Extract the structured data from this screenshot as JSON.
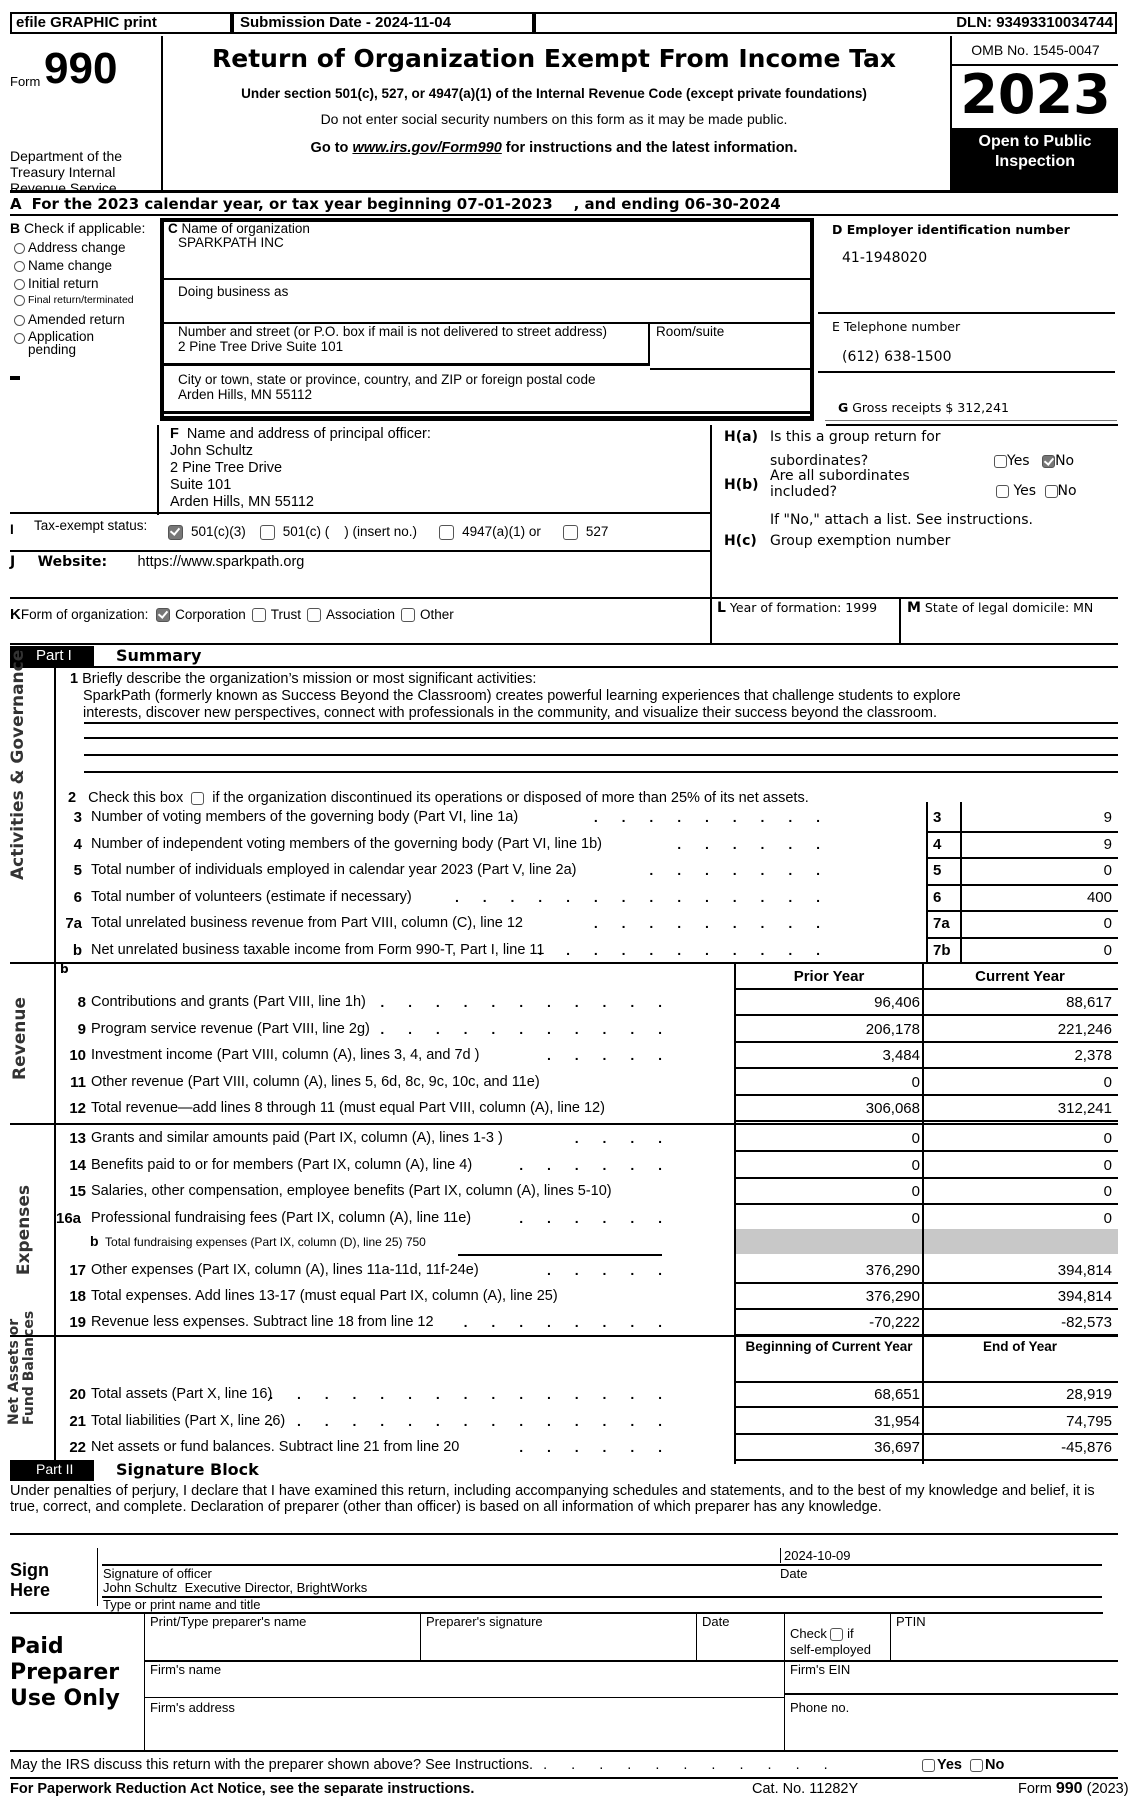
{
  "header": {
    "efile_label": "efile GRAPHIC print",
    "submission_date": "Submission Date - 2024-11-04",
    "dln": "DLN: 93493310034744",
    "form_prefix": "Form",
    "form_number": "990",
    "dept": "Department of the Treasury Internal Revenue Service",
    "title": "Return of Organization Exempt From Income Tax",
    "subtitle": "Under section 501(c), 527, or 4947(a)(1) of the Internal Revenue Code (except private foundations)",
    "ssn_notice": "Do not enter social security numbers on this form as it may be made public.",
    "goto_prefix": "Go to ",
    "goto_link": "www.irs.gov/Form990",
    "goto_suffix": " for instructions and the latest information.",
    "omb": "OMB No. 1545-0047",
    "year": "2023",
    "open_public": "Open to Public Inspection"
  },
  "line_a": {
    "label": "A",
    "text": "For the 2023 calendar year, or tax year beginning 07-01-2023    , and ending 06-30-2024"
  },
  "section_b": {
    "title": "Check if applicable:",
    "letter": "B",
    "items": [
      {
        "label": "Address change",
        "checked": false
      },
      {
        "label": "Name change",
        "checked": false
      },
      {
        "label": "Initial return",
        "checked": false
      },
      {
        "label": "Final return/terminated",
        "checked": false
      },
      {
        "label": "Amended return",
        "checked": false
      },
      {
        "label": "Application pending",
        "checked": false
      }
    ]
  },
  "section_c": {
    "letter": "C",
    "name_label": "Name of organization",
    "name_value": "SPARKPATH INC",
    "dba_label": "Doing business as",
    "dba_value": "",
    "street_label": "Number and street (or P.O. box if mail is not delivered to street address)",
    "street_value": "2 Pine Tree Drive Suite 101",
    "room_label": "Room/suite",
    "room_value": "",
    "city_label": "City or town, state or province, country, and ZIP or foreign postal code",
    "city_value": "Arden Hills, MN  55112"
  },
  "section_d": {
    "label": "D Employer identification number",
    "value": "41-1948020"
  },
  "section_e": {
    "label": "E Telephone number",
    "value": "(612) 638-1500"
  },
  "section_g": {
    "letter": "G",
    "label": "Gross receipts $",
    "value": "312,241"
  },
  "section_f": {
    "letter": "F",
    "label": "Name and address of principal officer:",
    "lines": [
      "John Schultz",
      "2 Pine Tree Drive",
      "Suite 101",
      "Arden Hills, MN  55112"
    ]
  },
  "section_h": {
    "ha_label": "H(a)",
    "ha_text1": "Is this a group return for",
    "ha_text2": "subordinates?",
    "ha_yes": "Yes",
    "ha_no": "No",
    "ha_yes_checked": false,
    "ha_no_checked": true,
    "hb_label": "H(b)",
    "hb_text1": "Are all subordinates",
    "hb_text2": "included?",
    "hb_yes": "Yes",
    "hb_no": "No",
    "hb_yes_checked": false,
    "hb_no_checked": false,
    "hb_note": "If \"No,\" attach a list. See instructions.",
    "hc_label": "H(c)",
    "hc_text": "Group exemption number"
  },
  "section_i": {
    "letter": "I",
    "label": "Tax-exempt status:",
    "options": [
      {
        "label": "501(c)(3)",
        "checked": true
      },
      {
        "label": "501(c) (    ) (insert no.)",
        "checked": false
      },
      {
        "label": "4947(a)(1) or",
        "checked": false
      },
      {
        "label": "527",
        "checked": false
      }
    ]
  },
  "section_j": {
    "letter": "J",
    "label": "Website:",
    "value": "https://www.sparkpath.org"
  },
  "section_k": {
    "letter": "K",
    "label": "Form of organization:",
    "options": [
      {
        "label": "Corporation",
        "checked": true
      },
      {
        "label": "Trust",
        "checked": false
      },
      {
        "label": "Association",
        "checked": false
      },
      {
        "label": "Other",
        "checked": false
      }
    ]
  },
  "section_l": {
    "letter": "L",
    "text": "Year of formation: 1999"
  },
  "section_m": {
    "letter": "M",
    "text": "State of legal domicile: MN"
  },
  "part1": {
    "part_label": "Part I",
    "title": "Summary",
    "side_governance": "Activities & Governance",
    "side_revenue": "Revenue",
    "side_expenses": "Expenses",
    "side_net_assets_1": "Net Assets or",
    "side_net_assets_2": "Fund Balances",
    "line1_num": "1",
    "line1_label": "Briefly describe the organization’s mission or most significant activities:",
    "line1_text1": "SparkPath (formerly known as Success Beyond the Classroom) creates powerful learning experiences that challenge students to explore",
    "line1_text2": "interests, discover new perspectives, connect with professionals in the community, and visualize their success beyond the classroom.",
    "line2_num": "2",
    "line2_pre": "Check this box",
    "line2_post": "if the organization discontinued its operations or disposed of more than 25% of its net assets.",
    "gov_lines": [
      {
        "num": "3",
        "label": "Number of voting members of the governing body (Part VI, line 1a)",
        "dots": ". . . . . . . . .",
        "box": "3",
        "value": "9"
      },
      {
        "num": "4",
        "label": "Number of independent voting members of the governing body (Part VI, line 1b)",
        "dots": ". . . . . .",
        "box": "4",
        "value": "9"
      },
      {
        "num": "5",
        "label": "Total number of individuals employed in calendar year 2023 (Part V, line 2a)",
        "dots": ". . . . . . .",
        "box": "5",
        "value": "0"
      },
      {
        "num": "6",
        "label": "Total number of volunteers (estimate if necessary)",
        "dots": ". . . . . . . . . . . . . .",
        "box": "6",
        "value": "400"
      },
      {
        "num": "7a",
        "label": "Total unrelated business revenue from Part VIII, column (C), line 12",
        "dots": ". . . . . . . . .",
        "box": "7a",
        "value": "0"
      },
      {
        "num": "b",
        "label": "Net unrelated business taxable income from Form 990-T, Part I, line 11",
        "dots": ". . . . . . . . . . .",
        "box": "7b",
        "value": "0"
      }
    ],
    "col_prior": "Prior Year",
    "col_current": "Current Year",
    "revenue_lines": [
      {
        "num": "8",
        "label": "Contributions and grants (Part VIII, line 1h)",
        "dots": ". . . . . . . . . . .",
        "prior": "96,406",
        "current": "88,617"
      },
      {
        "num": "9",
        "label": "Program service revenue (Part VIII, line 2g)",
        "dots": ". . . . . . . . . . .",
        "prior": "206,178",
        "current": "221,246"
      },
      {
        "num": "10",
        "label": "Investment income (Part VIII, column (A), lines 3, 4, and 7d )",
        "dots": ". . . . .",
        "prior": "3,484",
        "current": "2,378"
      },
      {
        "num": "11",
        "label": "Other revenue (Part VIII, column (A), lines 5, 6d, 8c, 9c, 10c, and 11e)",
        "dots": "",
        "prior": "0",
        "current": "0"
      },
      {
        "num": "12",
        "label": "Total revenue—add lines 8 through 11 (must equal Part VIII, column (A), line 12)",
        "dots": "",
        "prior": "306,068",
        "current": "312,241"
      }
    ],
    "expense_lines": [
      {
        "num": "13",
        "label": "Grants and similar amounts paid (Part IX, column (A), lines 1-3 )",
        "dots": ". . . .",
        "prior": "0",
        "current": "0"
      },
      {
        "num": "14",
        "label": "Benefits paid to or for members (Part IX, column (A), line 4)",
        "dots": ". . . . . .",
        "prior": "0",
        "current": "0"
      },
      {
        "num": "15",
        "label": "Salaries, other compensation, employee benefits (Part IX, column (A), lines 5-10)",
        "dots": "",
        "prior": "0",
        "current": "0"
      },
      {
        "num": "16a",
        "label": "Professional fundraising fees (Part IX, column (A), line 11e)",
        "dots": ". . . . . .",
        "prior": "0",
        "current": "0"
      }
    ],
    "line16b_num": "b",
    "line16b_label": "Total fundraising expenses (Part IX, column (D), line 25) 750",
    "expense_lines2": [
      {
        "num": "17",
        "label": "Other expenses (Part IX, column (A), lines 11a-11d, 11f-24e)",
        "dots": ". . . . .",
        "prior": "376,290",
        "current": "394,814"
      },
      {
        "num": "18",
        "label": "Total expenses. Add lines 13-17 (must equal Part IX, column (A), line 25)",
        "dots": "",
        "prior": "376,290",
        "current": "394,814"
      },
      {
        "num": "19",
        "label": "Revenue less expenses. Subtract line 18 from line 12",
        "dots": ". . . . . . . .",
        "prior": "-70,222",
        "current": "-82,573"
      }
    ],
    "col_begin": "Beginning of Current Year",
    "col_end": "End of Year",
    "net_lines": [
      {
        "num": "20",
        "label": "Total assets (Part X, line 16)",
        "dots": ". . . . . . . . . . . . . . .",
        "begin": "68,651",
        "end": "28,919"
      },
      {
        "num": "21",
        "label": "Total liabilities (Part X, line 26)",
        "dots": ". . . . . . . . . . . . . . .",
        "begin": "31,954",
        "end": "74,795"
      },
      {
        "num": "22",
        "label": "Net assets or fund balances. Subtract line 21 from line 20",
        "dots": ". . . . . .",
        "begin": "36,697",
        "end": "-45,876"
      }
    ]
  },
  "part2": {
    "part_label": "Part II",
    "title": "Signature Block",
    "perjury_text": "Under penalties of perjury, I declare that I have examined this return, including accompanying schedules and statements, and to the best of my knowledge and belief, it is true, correct, and complete. Declaration of preparer (other than officer) is based on all information of which preparer has any knowledge.",
    "sign_here_1": "Sign",
    "sign_here_2": "Here",
    "sig_date": "2024-10-09",
    "sig_officer_label": "Signature of officer",
    "date_label": "Date",
    "officer_name": "John Schultz  Executive Director, BrightWorks",
    "name_title_label": "Type or print name and title"
  },
  "preparer": {
    "title_1": "Paid",
    "title_2": "Preparer",
    "title_3": "Use Only",
    "name_label": "Print/Type preparer's name",
    "sig_label": "Preparer's signature",
    "date_label": "Date",
    "check_label_1": "Check",
    "check_label_2": "if",
    "check_label_3": "self-employed",
    "ptin_label": "PTIN",
    "firm_name_label": "Firm's name",
    "firm_ein_label": "Firm's EIN",
    "firm_address_label": "Firm's address",
    "phone_label": "Phone no."
  },
  "footer": {
    "discuss_text": "May the IRS discuss this return with the preparer shown above? See Instructions.",
    "discuss_dots": ". . . . . . . . . . .",
    "yes": "Yes",
    "no": "No",
    "paperwork": "For Paperwork Reduction Act Notice, see the separate instructions.",
    "cat_no": "Cat. No. 11282Y",
    "form_prefix": "Form",
    "form_num": "990",
    "form_year": "(2023)"
  }
}
